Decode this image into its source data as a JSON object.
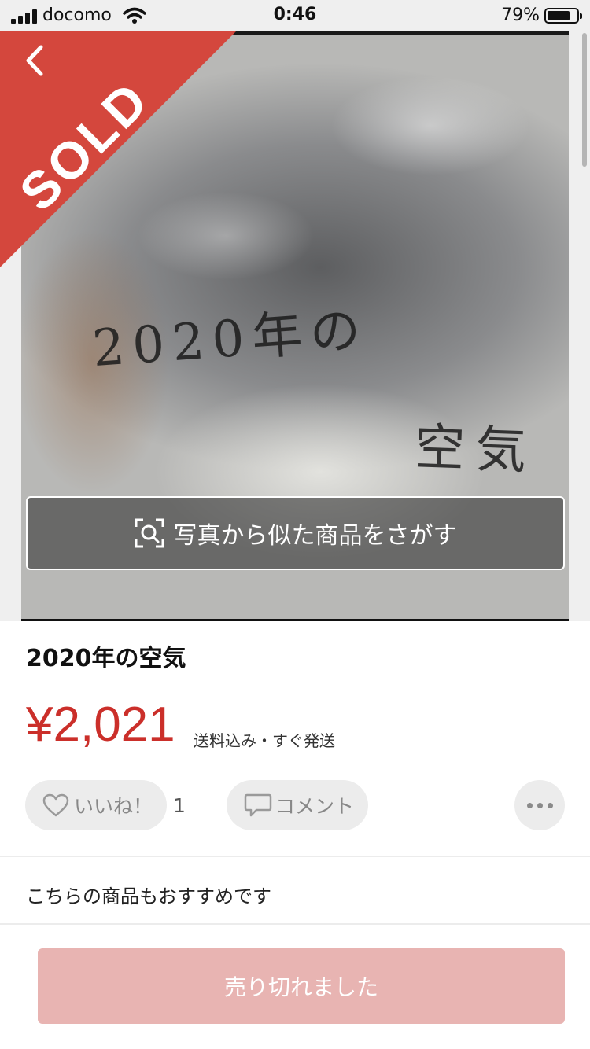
{
  "status_bar": {
    "carrier": "docomo",
    "time": "0:46",
    "battery": "79%",
    "battery_level": 0.79
  },
  "photo": {
    "sold_badge": "SOLD",
    "handwriting_line1": "2020年の",
    "handwriting_line2": "空気",
    "image_search_label": "写真から似た商品をさがす"
  },
  "item": {
    "title": "2020年の空気",
    "price": "¥2,021",
    "shipping_note": "送料込み・すぐ発送"
  },
  "actions": {
    "like_label": "いいね！",
    "like_count": "1",
    "comment_label": "コメント"
  },
  "recommendations": {
    "label": "こちらの商品もおすすめです"
  },
  "purchase": {
    "button_label": "売り切れました"
  },
  "colors": {
    "price_red": "#cb2f2a",
    "sold_ribbon": "#d4473d",
    "sold_out_button": "#e8b4b2"
  }
}
